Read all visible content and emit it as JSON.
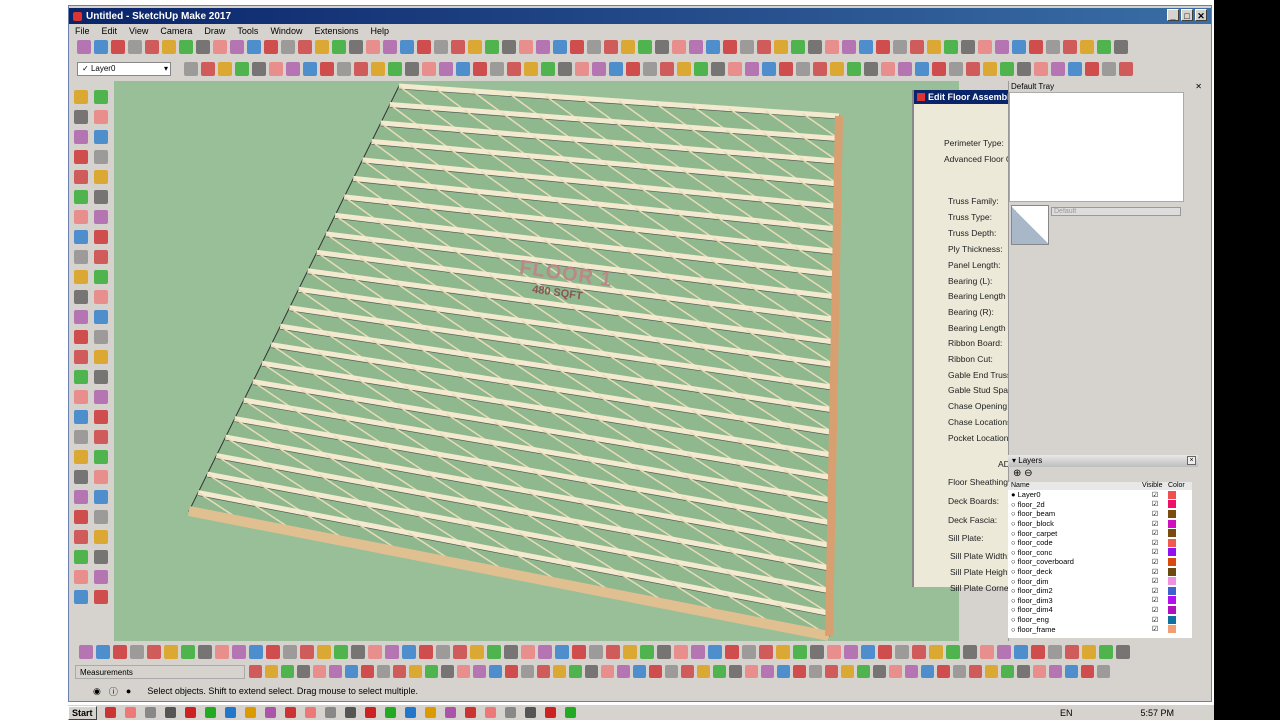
{
  "window": {
    "title": "Untitled - SketchUp Make 2017",
    "controls": [
      "_",
      "□",
      "✕"
    ]
  },
  "menu": [
    "File",
    "Edit",
    "View",
    "Camera",
    "Draw",
    "Tools",
    "Window",
    "Extensions",
    "Help"
  ],
  "layer_select": {
    "value": "Layer0"
  },
  "model_text": {
    "label": "FLOOR 1",
    "area": "480 SQFT"
  },
  "dialog": {
    "title": "Edit Floor Assembly",
    "fields": [
      "Perimeter Type:",
      "Advanced Floor O",
      "Truss Family:",
      "Truss Type:",
      "Truss Depth:",
      "Ply Thickness:",
      "Panel Length:",
      "Bearing (L):",
      "Bearing Length (L",
      "Bearing (R):",
      "Bearing Length (R",
      "Ribbon Board:",
      "Ribbon Cut:",
      "Gable End Truss",
      "Gable Stud Spac",
      "Chase Opening W",
      "Chase Locations",
      "Pocket Locations",
      "AD",
      "Floor Sheathing:",
      "Deck Boards:",
      "Deck Fascia:",
      "Sill Plate:",
      "Sill Plate Width:",
      "Sill Plate Height",
      "Sill Plate Corner"
    ]
  },
  "tray": {
    "title": "Default Tray",
    "style_name": "Default",
    "layers_title": "Layers",
    "col_name": "Name",
    "col_visible": "Visible",
    "col_color": "Color"
  },
  "layers": [
    {
      "name": "Layer0",
      "active": true,
      "color": "#f05050"
    },
    {
      "name": "floor_2d",
      "color": "#f0106a"
    },
    {
      "name": "floor_beam",
      "color": "#7a4a10"
    },
    {
      "name": "floor_block",
      "color": "#d010c0"
    },
    {
      "name": "floor_carpet",
      "color": "#7a4a10"
    },
    {
      "name": "floor_code",
      "color": "#f05a50"
    },
    {
      "name": "floor_conc",
      "color": "#9010f0"
    },
    {
      "name": "floor_coverboard",
      "color": "#d84a10"
    },
    {
      "name": "floor_deck",
      "color": "#6a4a10"
    },
    {
      "name": "floor_dim",
      "color": "#f090e0"
    },
    {
      "name": "floor_dim2",
      "color": "#4060d0"
    },
    {
      "name": "floor_dim3",
      "color": "#b010f0"
    },
    {
      "name": "floor_dim4",
      "color": "#b010c0"
    },
    {
      "name": "floor_eng",
      "color": "#1070a0"
    },
    {
      "name": "floor_frame",
      "color": "#f0a070"
    }
  ],
  "measurements_label": "Measurements",
  "status_text": "Select objects. Shift to extend select. Drag mouse to select multiple.",
  "taskbar": {
    "start": "Start",
    "lang": "EN",
    "clock": "5:57 PM"
  }
}
